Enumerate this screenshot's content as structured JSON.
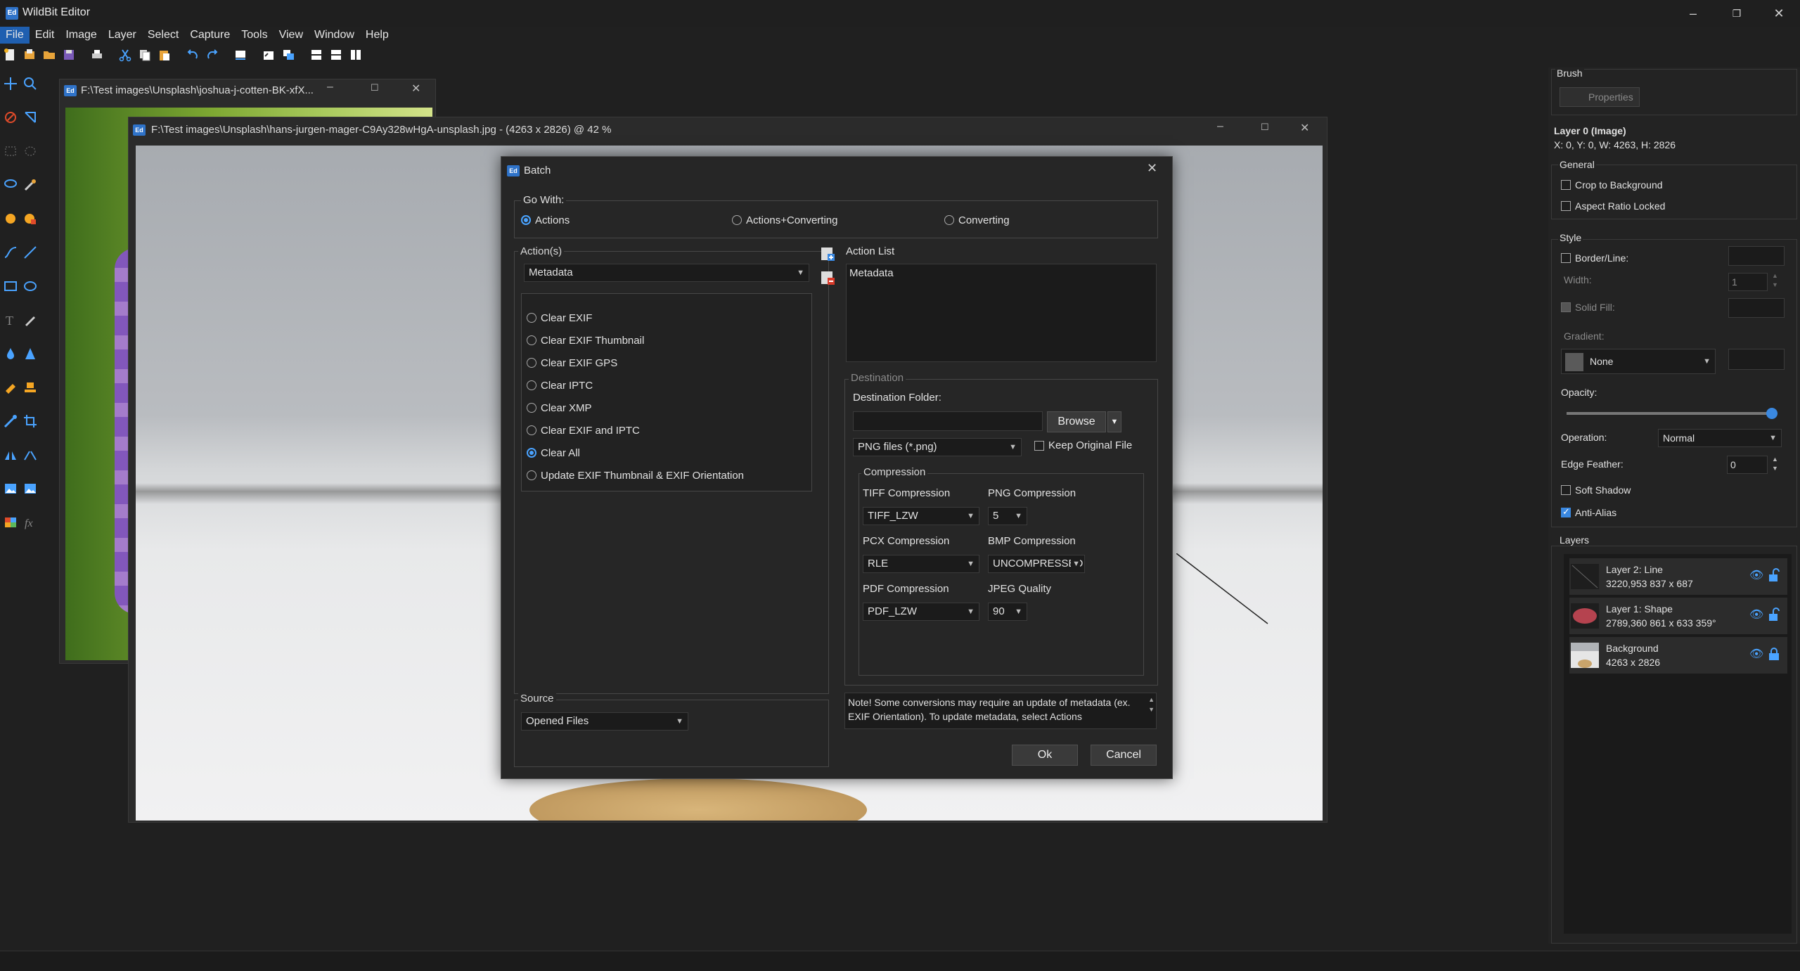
{
  "app": {
    "title": "WildBit Editor",
    "logo": "Ed"
  },
  "menu": [
    "File",
    "Edit",
    "Image",
    "Layer",
    "Select",
    "Capture",
    "Tools",
    "View",
    "Window",
    "Help"
  ],
  "doc_back": {
    "title": "F:\\Test images\\Unsplash\\joshua-j-cotten-BK-xfX..."
  },
  "doc_front": {
    "title": "F:\\Test images\\Unsplash\\hans-jurgen-mager-C9Ay328wHgA-unsplash.jpg - (4263 x 2826) @ 42  %"
  },
  "dialog": {
    "title": "Batch",
    "go_with": {
      "label": "Go With:",
      "options": [
        "Actions",
        "Actions+Converting",
        "Converting"
      ],
      "selected": "Actions"
    },
    "actions": {
      "label": "Action(s)",
      "selected": "Metadata",
      "items": [
        "Clear EXIF",
        "Clear EXIF Thumbnail",
        "Clear EXIF GPS",
        "Clear IPTC",
        "Clear XMP",
        "Clear EXIF and IPTC",
        "Clear All",
        "Update EXIF Thumbnail & EXIF Orientation"
      ],
      "checked": "Clear All"
    },
    "action_list": {
      "label": "Action List",
      "items": [
        "Metadata"
      ]
    },
    "destination": {
      "label": "Destination",
      "folder_label": "Destination Folder:",
      "folder_value": "",
      "browse": "Browse",
      "format": "PNG files (*.png)",
      "keep_original": "Keep Original File",
      "compression": {
        "label": "Compression",
        "tiff_label": "TIFF Compression",
        "tiff_value": "TIFF_LZW",
        "png_label": "PNG Compression",
        "png_value": "5",
        "pcx_label": "PCX Compression",
        "pcx_value": "RLE",
        "bmp_label": "BMP Compression",
        "bmp_value": "UNCOMPRESSED",
        "pdf_label": "PDF Compression",
        "pdf_value": "PDF_LZW",
        "jpeg_label": "JPEG Quality",
        "jpeg_value": "90"
      }
    },
    "source": {
      "label": "Source",
      "value": "Opened Files"
    },
    "note": "Note! Some conversions may require an update of metadata (ex. EXIF Orientation). To update metadata, select Actions",
    "ok": "Ok",
    "cancel": "Cancel"
  },
  "right_panel": {
    "brush_label": "Brush",
    "properties_button": "Properties",
    "layer_name": "Layer 0 (Image)",
    "layer_geom": "X: 0, Y: 0, W: 4263, H: 2826",
    "general": {
      "label": "General",
      "crop": "Crop to Background",
      "aspect": "Aspect Ratio Locked"
    },
    "style": {
      "label": "Style",
      "border": "Border/Line:",
      "width_label": "Width:",
      "width_value": "1",
      "solid_fill": "Solid Fill:",
      "gradient_label": "Gradient:",
      "gradient_value": "None",
      "opacity_label": "Opacity:",
      "opacity": 1.0,
      "operation_label": "Operation:",
      "operation_value": "Normal",
      "feather_label": "Edge Feather:",
      "feather_value": "0",
      "soft_shadow": "Soft Shadow",
      "anti_alias": "Anti-Alias"
    },
    "layers_label": "Layers",
    "layers": [
      {
        "name": "Layer 2: Line",
        "info": "3220,953  837 x 687"
      },
      {
        "name": "Layer 1: Shape",
        "info": "2789,360  861 x 633  359°"
      },
      {
        "name": "Background",
        "info": "4263 x 2826"
      }
    ]
  },
  "colors": {
    "accent": "#3a88e0",
    "menu_active": "#1f5fb0"
  }
}
